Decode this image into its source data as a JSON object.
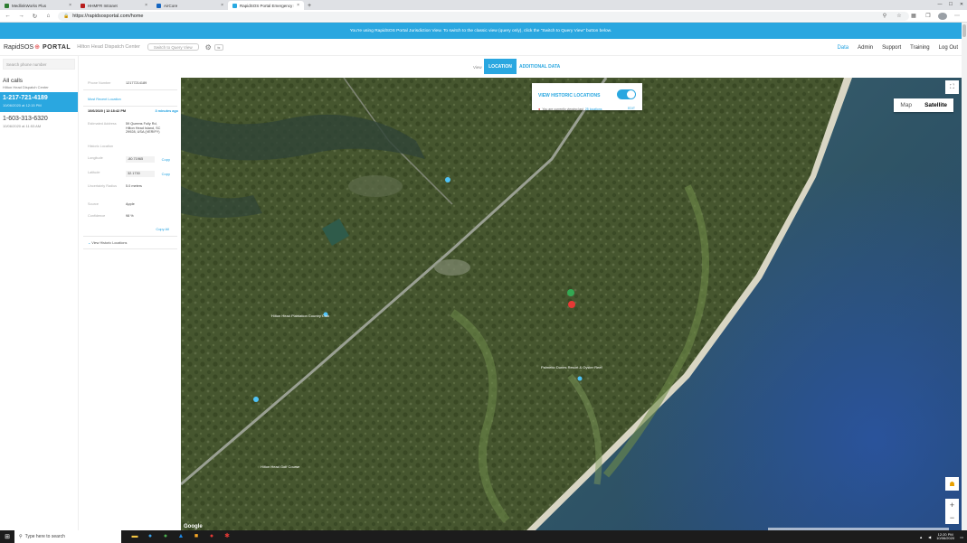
{
  "browser": {
    "tabs": [
      {
        "label": "MedlinkWorks Plus",
        "color": "#2e7d32",
        "active": false
      },
      {
        "label": "HHMFR Intranet",
        "color": "#b71c1c",
        "active": false
      },
      {
        "label": "AirCore",
        "color": "#1565c0",
        "active": false
      },
      {
        "label": "RapidSOS Portal Emergency Incide",
        "color": "#29a9e1",
        "active": true
      }
    ],
    "new_tab": "+",
    "url": "https://rapidsosportal.com/home"
  },
  "banner": {
    "text": "You're using RapidSOS Portal Jurisdiction View. To switch to the classic view (query only), click the \"Switch to Query View\" button below."
  },
  "header": {
    "logo_text": "RapidSOS",
    "logo_portal": "PORTAL",
    "center_name": "Hilton Head Dispatch Center",
    "query_view_button": "Switch to Query View",
    "nav": [
      {
        "label": "Data",
        "active": true
      },
      {
        "label": "Admin",
        "active": false
      },
      {
        "label": "Support",
        "active": false
      },
      {
        "label": "Training",
        "active": false
      },
      {
        "label": "Log Out",
        "active": false
      }
    ]
  },
  "calls": {
    "search_placeholder": "Search phone number",
    "all_calls_title": "All calls",
    "all_calls_sub": "Hilton Head Dispatch Center",
    "items": [
      {
        "number": "1-217-721-4189",
        "datetime": "10/06/2020 at 12:15 PM",
        "selected": true
      },
      {
        "number": "1-603-313-6320",
        "datetime": "10/06/2020 at 11:53 AM",
        "selected": false
      }
    ]
  },
  "details": {
    "phone_label": "Phone Number",
    "phone_value": "12177214189",
    "recent_label": "Most Recent Location",
    "timestamp": "10/6/2020 | 12:18:42 PM",
    "age": "3 minutes ago",
    "address_label": "Estimated Address",
    "address_line1": "59 Queens Folly Rd,",
    "address_line2": "Hilton Head Island, SC",
    "address_line3": "29928, USA (VERIFY)",
    "history_label": "Historic Location",
    "longitude_label": "Longitude",
    "longitude_value": "-80.71965",
    "latitude_label": "Latitude",
    "latitude_value": "32.1730",
    "copy": "Copy",
    "uncertainty_label": "Uncertainty Radius",
    "uncertainty_value": "5.0 meters",
    "source_label": "Source",
    "source_value": "Apple",
    "confidence_label": "Confidence",
    "confidence_value": "98 %",
    "copy_all": "Copy All",
    "view_historic": "View Historic Locations"
  },
  "view_tabs": {
    "label": "View",
    "location": "LOCATION",
    "additional": "ADDITIONAL DATA"
  },
  "map": {
    "historic_title": "VIEW HISTORIC LOCATIONS",
    "historic_on": true,
    "historic_info_prefix": "You are currently viewing last",
    "historic_info_link": "25 locations",
    "historic_edit": "EDIT",
    "type_map": "Map",
    "type_satellite": "Satellite",
    "google": "Google",
    "labels": {
      "label_left": "Hilton Head Plantation Country Club",
      "label_mid": "Palmetto Dunes Resort & Oyster Reef",
      "label_bottom": "Hilton Head Golf Course"
    }
  },
  "taskbar": {
    "search_text": "Type here to search",
    "time": "12:20 PM",
    "date": "10/06/2020"
  }
}
